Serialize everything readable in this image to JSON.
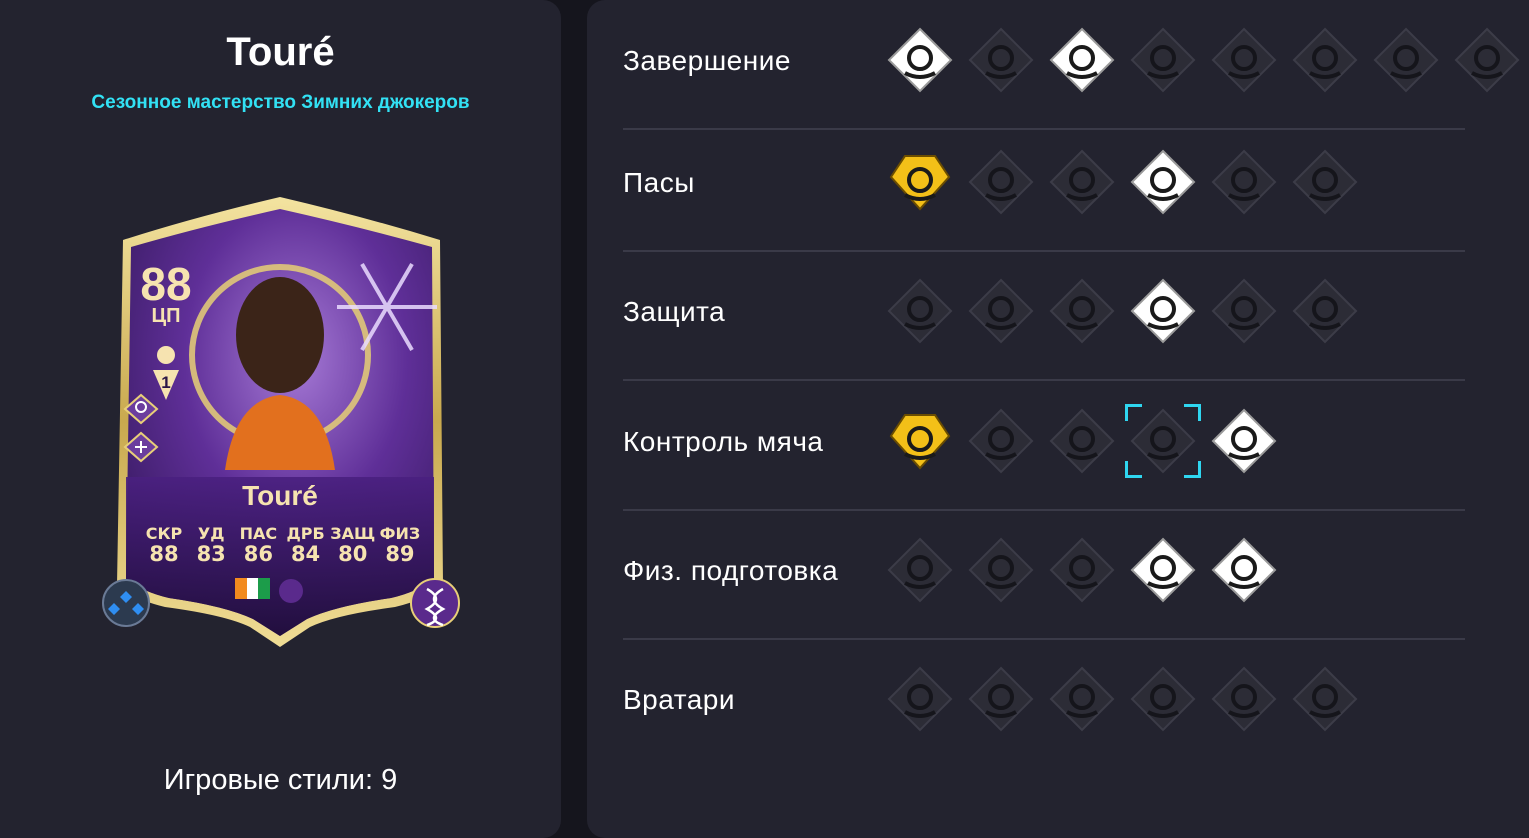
{
  "card": {
    "name_title": "Touré",
    "subtitle": "Сезонное мастерство Зимних джокеров",
    "rating": "88",
    "position": "ЦП",
    "tier": "1",
    "card_name": "Touré",
    "stats": [
      {
        "label": "СКР",
        "value": "88"
      },
      {
        "label": "УД",
        "value": "83"
      },
      {
        "label": "ПАС",
        "value": "86"
      },
      {
        "label": "ДРБ",
        "value": "84"
      },
      {
        "label": "ЗАЩ",
        "value": "80"
      },
      {
        "label": "ФИЗ",
        "value": "89"
      }
    ],
    "colors": {
      "accent": "#32e1f4",
      "card_gold": "#e8cf78",
      "card_purple": "#5a2a8c"
    }
  },
  "footer": {
    "playstyles_label": "Игровые стили: 9"
  },
  "categories": [
    {
      "label": "Завершение",
      "playstyles": [
        {
          "icon": "finesse-shot-icon",
          "state": "active"
        },
        {
          "icon": "chip-shot-icon",
          "state": "inactive"
        },
        {
          "icon": "power-shot-icon",
          "state": "active"
        },
        {
          "icon": "dead-ball-icon",
          "state": "inactive"
        },
        {
          "icon": "acrobatic-icon",
          "state": "inactive"
        },
        {
          "icon": "trickster-shot-icon",
          "state": "inactive"
        },
        {
          "icon": "low-driven-shot-icon",
          "state": "inactive"
        },
        {
          "icon": "gamechanger-icon",
          "state": "inactive"
        }
      ]
    },
    {
      "label": "Пасы",
      "playstyles": [
        {
          "icon": "pinged-pass-icon",
          "state": "plus"
        },
        {
          "icon": "long-ball-pass-icon",
          "state": "inactive"
        },
        {
          "icon": "whipped-pass-icon",
          "state": "inactive"
        },
        {
          "icon": "tiki-taka-icon",
          "state": "active"
        },
        {
          "icon": "inventive-icon",
          "state": "inactive"
        },
        {
          "icon": "incisive-pass-icon",
          "state": "inactive"
        }
      ]
    },
    {
      "label": "Защита",
      "playstyles": [
        {
          "icon": "jockey-icon",
          "state": "inactive"
        },
        {
          "icon": "block-icon",
          "state": "inactive"
        },
        {
          "icon": "intercept-icon",
          "state": "inactive"
        },
        {
          "icon": "anticipate-icon",
          "state": "active"
        },
        {
          "icon": "slide-tackle-icon",
          "state": "inactive"
        },
        {
          "icon": "aerial-fortress-icon",
          "state": "inactive"
        }
      ]
    },
    {
      "label": "Контроль мяча",
      "playstyles": [
        {
          "icon": "technical-icon",
          "state": "plus"
        },
        {
          "icon": "rapid-icon",
          "state": "inactive"
        },
        {
          "icon": "first-touch-icon",
          "state": "inactive"
        },
        {
          "icon": "trickster-icon",
          "state": "inactive",
          "focused": true
        },
        {
          "icon": "press-proven-icon",
          "state": "active"
        }
      ]
    },
    {
      "label": "Физ. подготовка",
      "playstyles": [
        {
          "icon": "quick-step-icon",
          "state": "inactive"
        },
        {
          "icon": "relentless-icon",
          "state": "inactive"
        },
        {
          "icon": "long-throw-icon",
          "state": "inactive"
        },
        {
          "icon": "bruiser-icon",
          "state": "active"
        },
        {
          "icon": "enforcer-icon",
          "state": "active"
        }
      ]
    },
    {
      "label": "Вратари",
      "playstyles": [
        {
          "icon": "far-throw-icon",
          "state": "inactive"
        },
        {
          "icon": "footwork-icon",
          "state": "inactive"
        },
        {
          "icon": "cross-claimer-icon",
          "state": "inactive"
        },
        {
          "icon": "rush-out-icon",
          "state": "inactive"
        },
        {
          "icon": "far-reach-icon",
          "state": "inactive"
        },
        {
          "icon": "deflector-icon",
          "state": "inactive"
        }
      ]
    }
  ]
}
